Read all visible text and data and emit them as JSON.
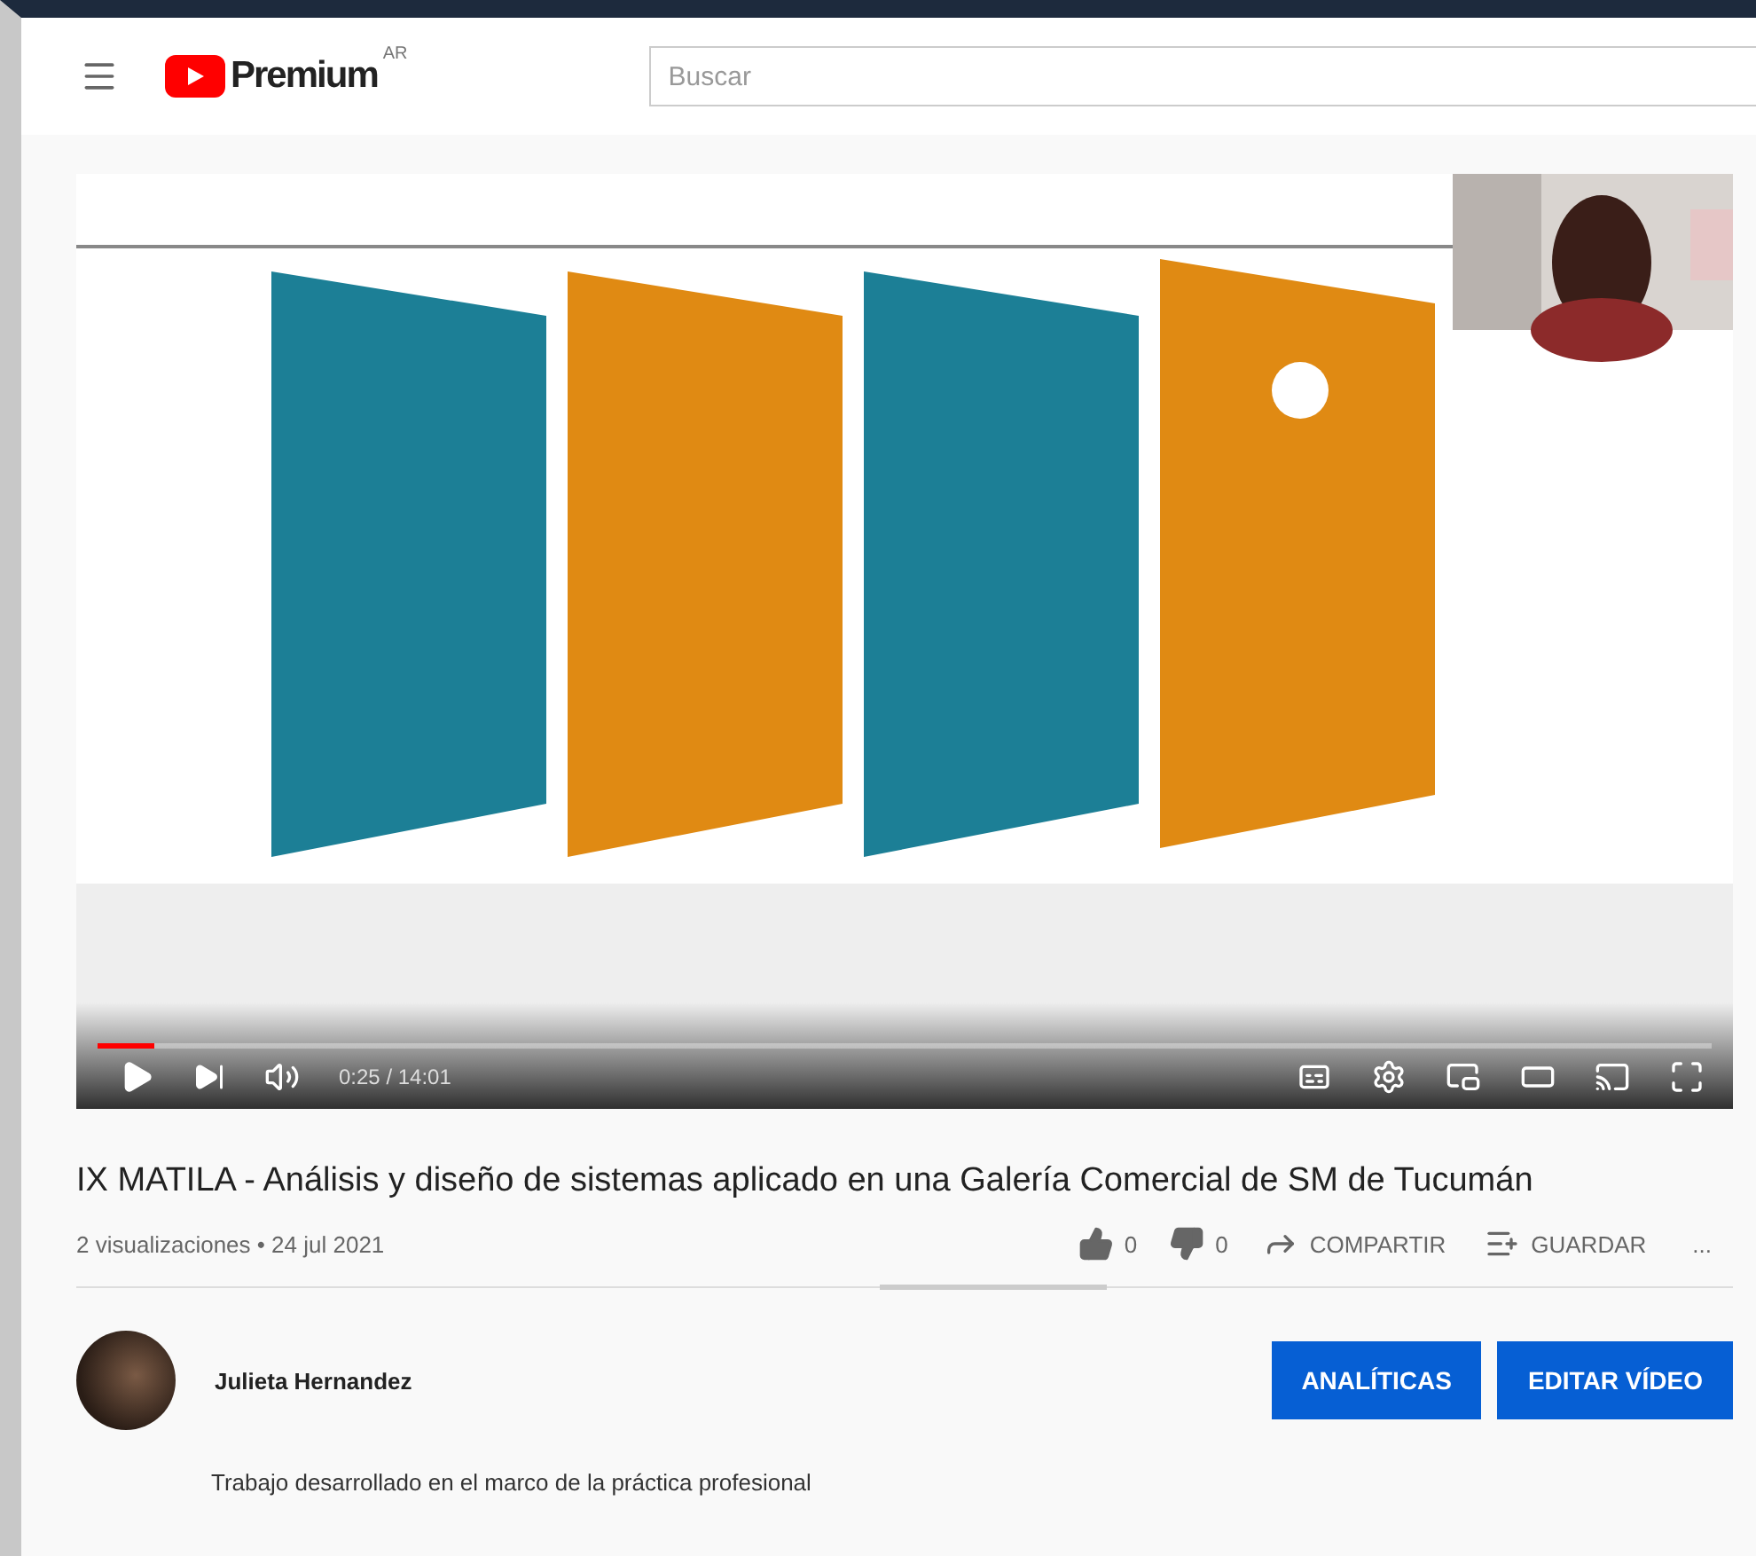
{
  "header": {
    "logo_text": "Premium",
    "region": "AR",
    "search": {
      "placeholder": "Buscar"
    }
  },
  "player": {
    "time": "0:25 / 14:01",
    "progress": {
      "level": 0.035
    },
    "playing": false
  },
  "video": {
    "title": "IX MATILA - Análisis y diseño de sistemas aplicado en una Galería Comercial de SM de Tucumán",
    "meta": "2 visualizaciones • 24 jul 2021",
    "actions": [
      {
        "kind": "like",
        "label": "0"
      },
      {
        "kind": "dislike",
        "label": "0"
      },
      {
        "kind": "share",
        "label": "COMPARTIR"
      },
      {
        "kind": "save",
        "label": "GUARDAR"
      },
      {
        "kind": "more",
        "label": "..."
      }
    ]
  },
  "channel": {
    "name": "Julieta Hernandez",
    "buttons": [
      "ANALÍTICAS",
      "EDITAR VÍDEO"
    ]
  },
  "description": "Trabajo desarrollado en el marco de la práctica profesional"
}
